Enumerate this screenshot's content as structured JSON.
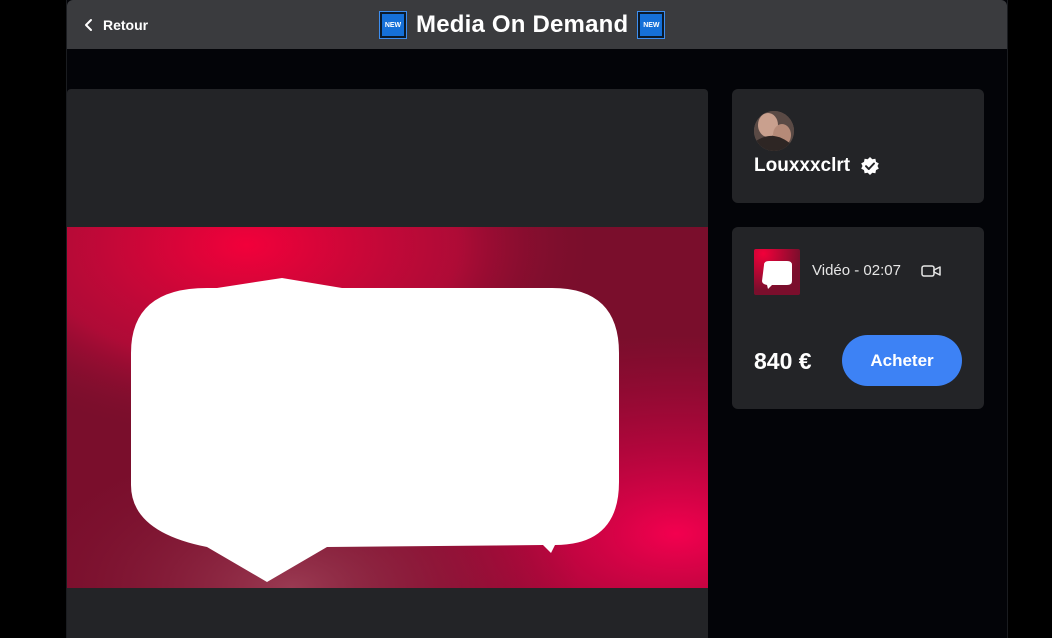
{
  "header": {
    "back_label": "Retour",
    "title": "Media On Demand",
    "badge_label": "NEW"
  },
  "creator": {
    "name": "Louxxxclrt"
  },
  "media": {
    "meta": "Vidéo - 02:07",
    "price": "840 €",
    "buy_label": "Acheter"
  },
  "colors": {
    "accent": "#3d82f5",
    "badge": "#1570d8",
    "panel": "#232427",
    "topbar": "#3a3b3e",
    "media_gradient_hot": "#f0003a",
    "media_gradient_dark": "#7a0e2c"
  },
  "icons": {
    "back": "chevron-left-icon",
    "verified": "verified-badge-icon",
    "video": "video-camera-icon",
    "chat": "chat-bubble-icon"
  }
}
